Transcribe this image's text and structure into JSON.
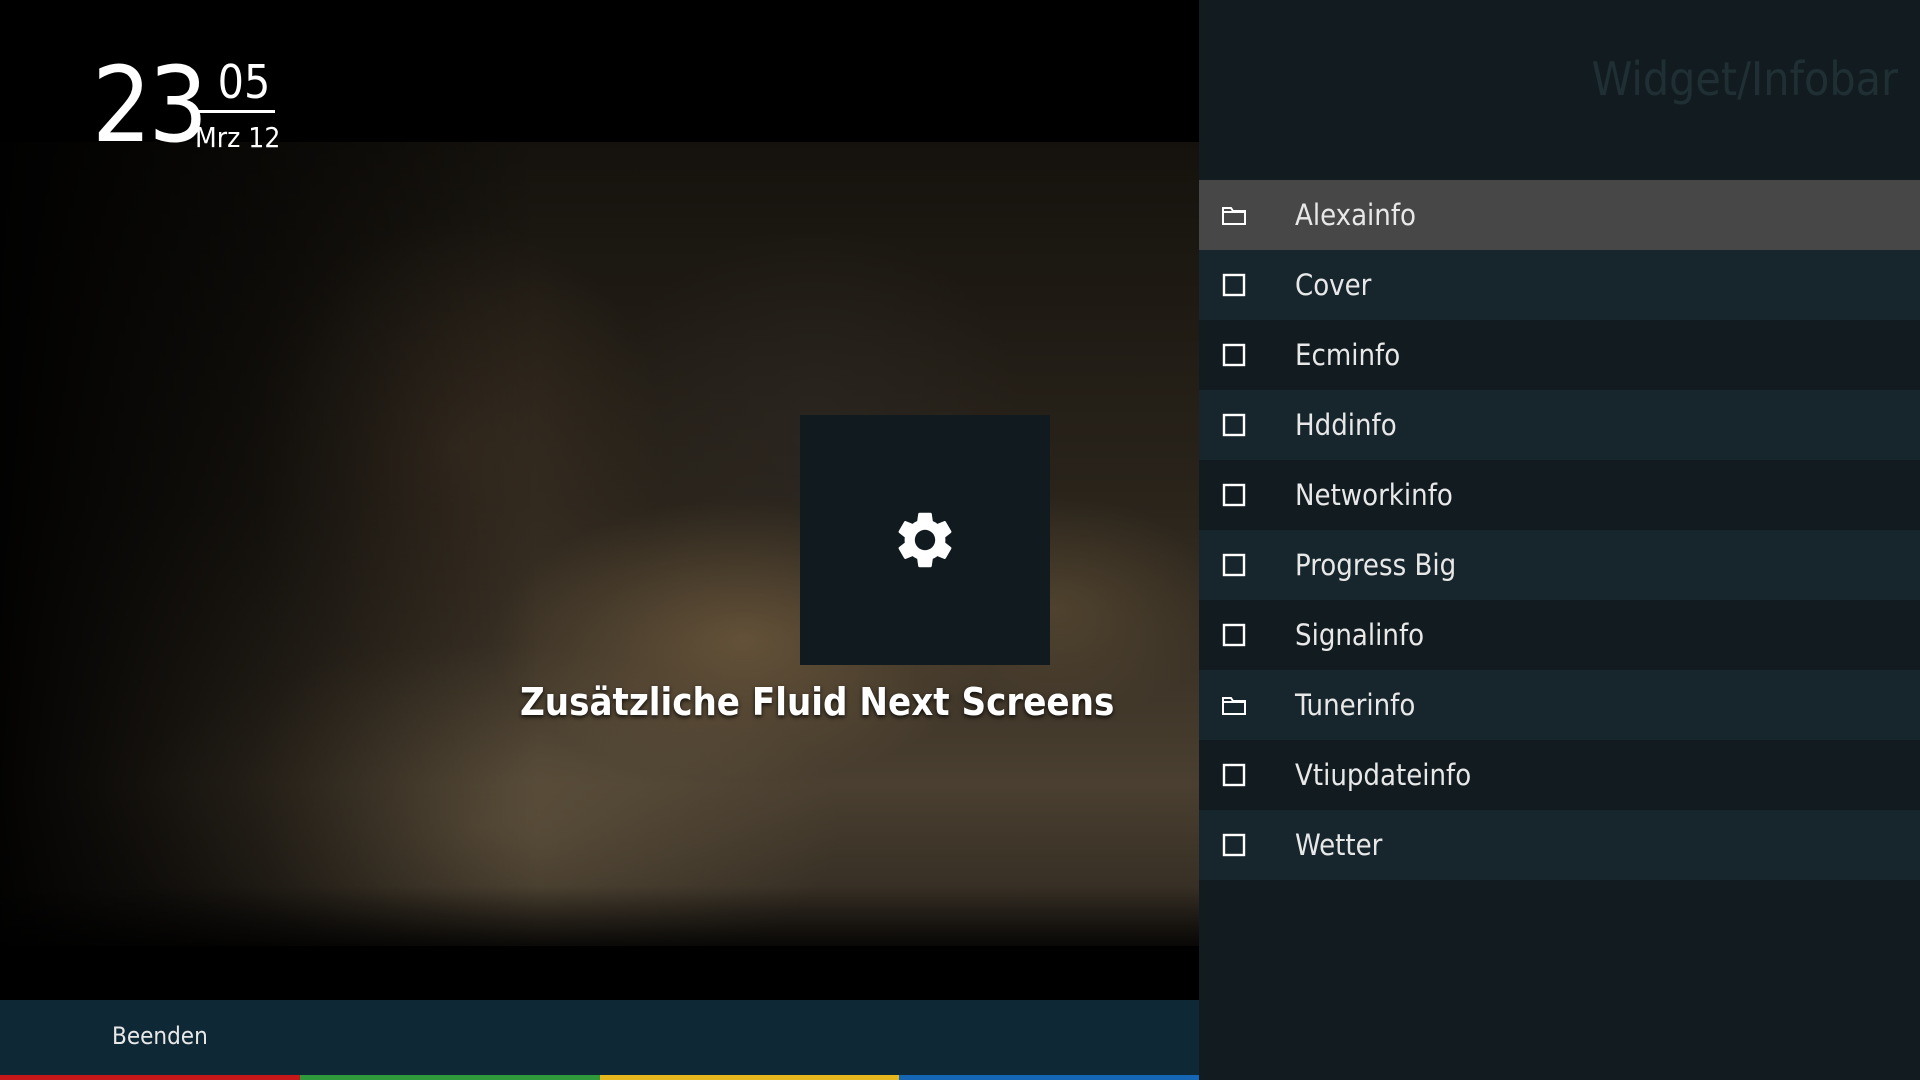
{
  "clock": {
    "hour": "23",
    "minute": "05",
    "date": "Mrz 12"
  },
  "center": {
    "caption": "Zusätzliche Fluid Next Screens",
    "tile_icon": "gear-icon"
  },
  "footer": {
    "exit_label": "Beenden",
    "color_keys": [
      "#c6171b",
      "#2f9a3c",
      "#e6b81e",
      "#1666b6"
    ]
  },
  "panel": {
    "title": "Widget/Infobar",
    "items": [
      {
        "label": "Alexainfo",
        "icon": "folder-icon",
        "selected": true
      },
      {
        "label": "Cover",
        "icon": "checkbox-icon",
        "selected": false
      },
      {
        "label": "Ecminfo",
        "icon": "checkbox-icon",
        "selected": false
      },
      {
        "label": "Hddinfo",
        "icon": "checkbox-icon",
        "selected": false
      },
      {
        "label": "Networkinfo",
        "icon": "checkbox-icon",
        "selected": false
      },
      {
        "label": "Progress Big",
        "icon": "checkbox-icon",
        "selected": false
      },
      {
        "label": "Signalinfo",
        "icon": "checkbox-icon",
        "selected": false
      },
      {
        "label": "Tunerinfo",
        "icon": "folder-icon",
        "selected": false
      },
      {
        "label": "Vtiupdateinfo",
        "icon": "checkbox-icon",
        "selected": false
      },
      {
        "label": "Wetter",
        "icon": "checkbox-icon",
        "selected": false
      }
    ]
  },
  "colors": {
    "panel_bg": "#121c20",
    "selected_bg": "#474747",
    "footer_bg": "#0f2835"
  }
}
